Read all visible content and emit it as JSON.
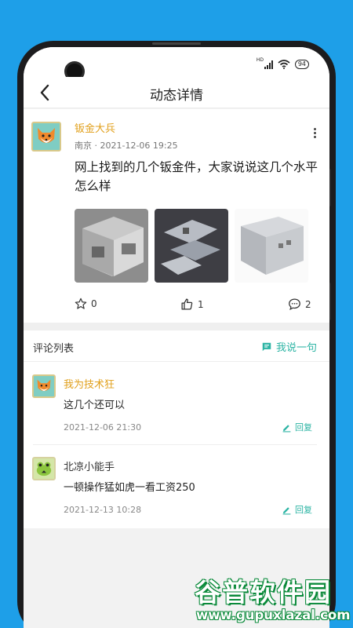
{
  "status_bar": {
    "hd_label": "HD",
    "battery": "94"
  },
  "nav": {
    "title": "动态详情"
  },
  "post": {
    "author": "钣金大兵",
    "meta": "南京 · 2021-12-06 19:25",
    "content": "网上找到的几个钣金件，大家说说这几个水平怎么样",
    "images": [
      "sheet-metal-box-photo",
      "sheet-metal-brackets-photo",
      "sheet-metal-frame-photo"
    ],
    "stats": {
      "favorites": "0",
      "likes": "1",
      "comments": "2"
    }
  },
  "comments": {
    "title": "评论列表",
    "say_label": "我说一句",
    "items": [
      {
        "author": "我为技术狂",
        "text": "这几个还可以",
        "time": "2021-12-06 21:30",
        "reply_label": "回复"
      },
      {
        "author": "北凉小能手",
        "text": "一顿操作猛如虎一看工资250",
        "time": "2021-12-13 10:28",
        "reply_label": "回复"
      }
    ]
  },
  "watermark": {
    "title": "谷普软件园",
    "url": "www.gupuxlazal.com"
  },
  "colors": {
    "accent": "#2cb4a4",
    "username": "#e1a01c",
    "background": "#1e9fe8"
  }
}
